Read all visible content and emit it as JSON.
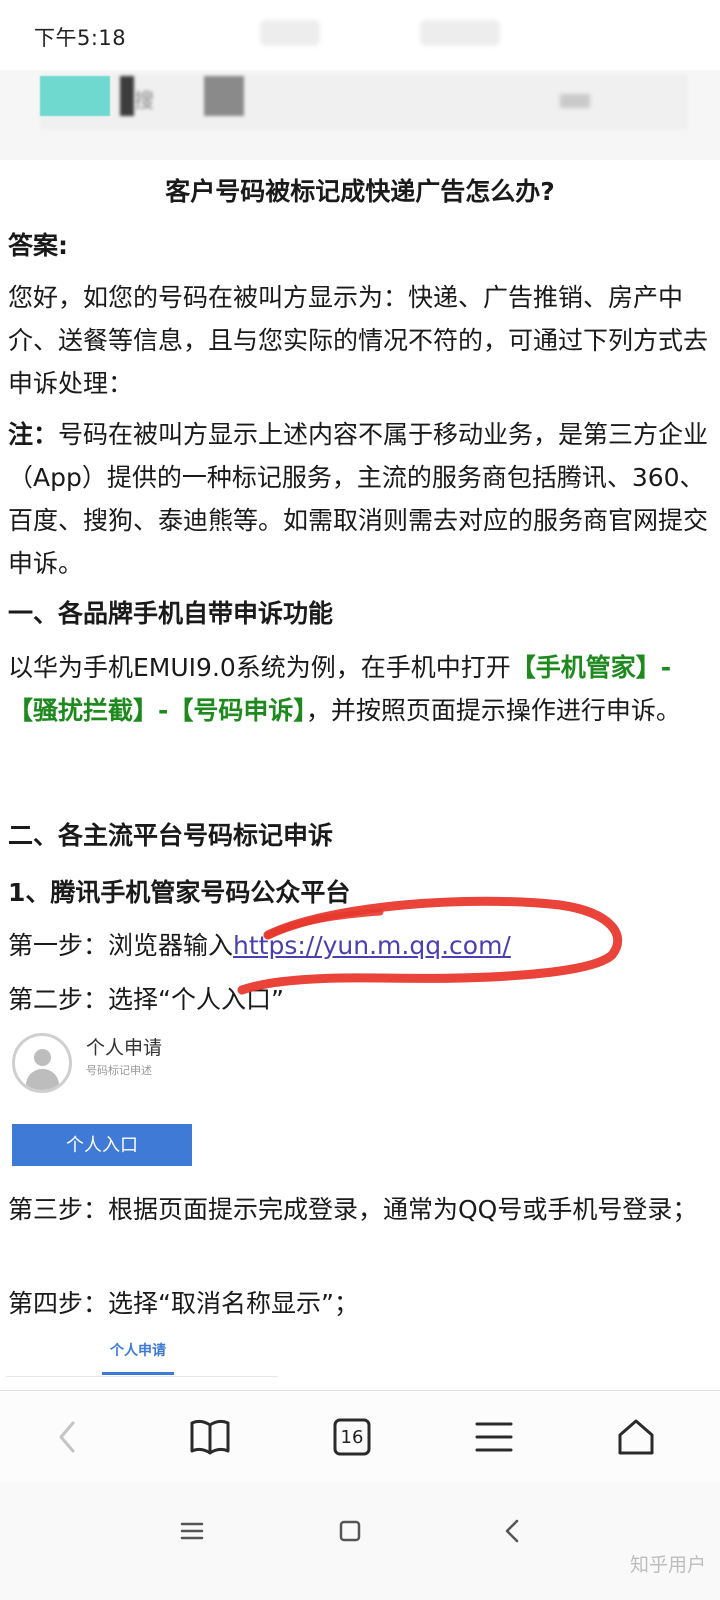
{
  "status_bar": {
    "time": "下午5:18"
  },
  "address_bar": {
    "label": "搜"
  },
  "article": {
    "title": "客户号码被标记成快递广告怎么办?",
    "answer_label": "答案:",
    "intro": "您好，如您的号码在被叫方显示为：快递、广告推销、房产中介、送餐等信息，且与您实际的情况不符的，可通过下列方式去申诉处理：",
    "note_label": "注：",
    "note_text": "号码在被叫方显示上述内容不属于移动业务，是第三方企业（App）提供的一种标记服务，主流的服务商包括腾讯、360、百度、搜狗、泰迪熊等。如需取消则需去对应的服务商官网提交申诉。",
    "section1_heading": "一、各品牌手机自带申诉功能",
    "section1_text_a": "以华为手机EMUI9.0系统为例，在手机中打开",
    "section1_green1": "【手机管家】-【骚扰拦截】-【号码申诉】",
    "section1_text_b": "，并按照页面提示操作进行申诉。",
    "section2_heading": "二、各主流平台号码标记申诉",
    "sub1_heading": "1、腾讯手机管家号码公众平台",
    "step1_label": "第一步：浏览器输入",
    "step1_link": "https://yun.m.qq.com/",
    "step2": "第二步：选择“个人入口”",
    "card_title": "个人申请",
    "card_subtitle": "号码标记申述",
    "entry_button": "个人入口",
    "step3": "第三步：根据页面提示完成登录，通常为QQ号或手机号登录；",
    "step4": "第四步：选择“取消名称显示”；",
    "tab_personal": "个人申请"
  },
  "browser_nav": {
    "tab_count": "16"
  },
  "watermark": "知乎用户",
  "colors": {
    "green": "#1e8a1e",
    "link": "#4a3fb0",
    "button_blue": "#3f7bd6",
    "scribble_red": "#e8392f"
  }
}
